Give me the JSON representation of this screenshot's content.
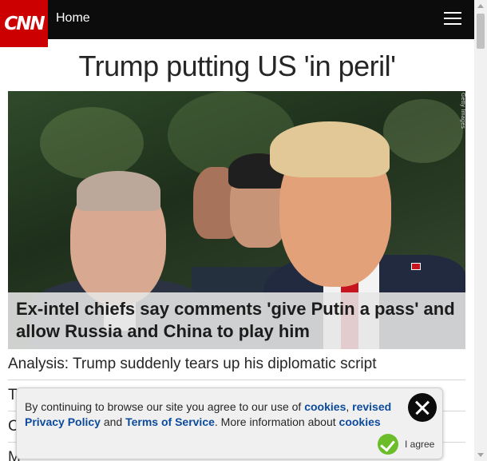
{
  "header": {
    "logo_text": "CNN",
    "home_label": "Home",
    "menu_icon": "hamburger-menu-icon"
  },
  "colors": {
    "brand_red": "#cc0000",
    "topbar": "#0c0c0c",
    "link_blue": "#0c4a9c",
    "agree_green": "#6cbd2a"
  },
  "main": {
    "headline": "Trump putting US 'in peril'",
    "hero": {
      "caption": "Ex-intel chiefs say comments 'give Putin a pass' and allow Russia and China to play him",
      "credit": "Getty Images"
    },
    "stories": [
      "Analysis: Trump suddenly tears up his diplomatic script",
      "T",
      "C",
      "M"
    ]
  },
  "cookie_banner": {
    "text_1": "By continuing to browse our site you agree to our use of ",
    "link_cookies": "cookies",
    "text_2": ", ",
    "link_privacy": "revised Privacy Policy",
    "text_3": " and ",
    "link_terms": "Terms of Service",
    "text_4": ". More information about ",
    "link_cookies_more": "cookies",
    "agree_label": "I agree",
    "close_icon": "close-icon"
  }
}
